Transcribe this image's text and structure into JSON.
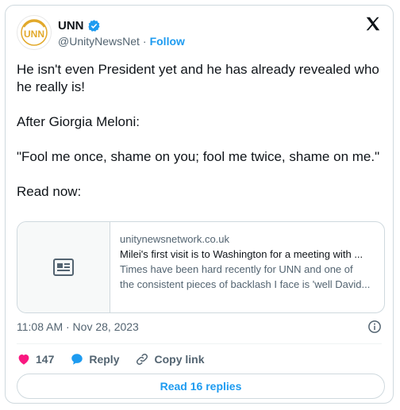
{
  "account": {
    "name": "UNN",
    "handle": "@UnityNewsNet",
    "separator": "·",
    "follow_label": "Follow",
    "avatar_text": "UNN"
  },
  "tweet": {
    "text": "He isn't even President yet and he has already revealed who he really is!\n\nAfter Giorgia Meloni:\n\n\"Fool me once, shame on you; fool me twice, shame on me.\"\n\nRead now:",
    "timestamp": "11:08 AM · Nov 28, 2023"
  },
  "link_card": {
    "domain": "unitynewsnetwork.co.uk",
    "title": "Milei's first visit is to Washington for a meeting with ...",
    "description_line1": "Times have been hard recently for UNN and one of",
    "description_line2": "the consistent pieces of backlash I face is 'well David..."
  },
  "actions": {
    "like_count": "147",
    "reply_label": "Reply",
    "copy_link_label": "Copy link"
  },
  "read_replies_label": "Read 16 replies",
  "colors": {
    "accent": "#1d9bf0",
    "like": "#f91880",
    "text_primary": "#0f1419",
    "text_secondary": "#536471",
    "border": "#cfd9de",
    "avatar_gold": "#e2a92b"
  },
  "icons": [
    "verified-badge-icon",
    "x-logo-icon",
    "article-icon",
    "info-icon",
    "heart-icon",
    "reply-bubble-icon",
    "link-icon"
  ]
}
